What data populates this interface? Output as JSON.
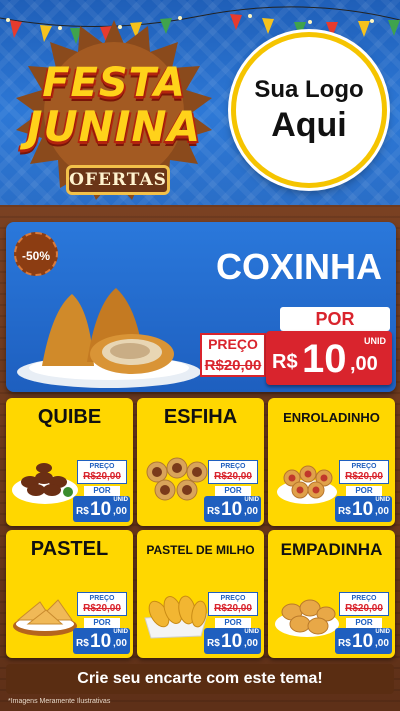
{
  "header": {
    "festa_line1": "FESTA",
    "festa_line2": "JUNINA",
    "ofertas": "OFERTAS",
    "logo_line1": "Sua Logo",
    "logo_line2": "Aqui"
  },
  "featured": {
    "discount": "-50%",
    "name": "COXINHA",
    "preco_label": "PREÇO",
    "old_price": "R$20,00",
    "por_label": "POR",
    "currency": "R$",
    "new_int": "10",
    "new_dec": ",00",
    "unit": "UNID"
  },
  "products": [
    {
      "name": "QUIBE",
      "preco_label": "PREÇO",
      "old_price": "R$20,00",
      "por_label": "POR",
      "currency": "R$",
      "new_int": "10",
      "new_dec": ",00",
      "unit": "UNID"
    },
    {
      "name": "ESFIHA",
      "preco_label": "PREÇO",
      "old_price": "R$20,00",
      "por_label": "POR",
      "currency": "R$",
      "new_int": "10",
      "new_dec": ",00",
      "unit": "UNID"
    },
    {
      "name": "ENROLADINHO",
      "preco_label": "PREÇO",
      "old_price": "R$20,00",
      "por_label": "POR",
      "currency": "R$",
      "new_int": "10",
      "new_dec": ",00",
      "unit": "UNID"
    },
    {
      "name": "PASTEL",
      "preco_label": "PREÇO",
      "old_price": "R$20,00",
      "por_label": "POR",
      "currency": "R$",
      "new_int": "10",
      "new_dec": ",00",
      "unit": "UNID"
    },
    {
      "name": "PASTEL DE MILHO",
      "preco_label": "PREÇO",
      "old_price": "R$20,00",
      "por_label": "POR",
      "currency": "R$",
      "new_int": "10",
      "new_dec": ",00",
      "unit": "UNID"
    },
    {
      "name": "EMPADINHA",
      "preco_label": "PREÇO",
      "old_price": "R$20,00",
      "por_label": "POR",
      "currency": "R$",
      "new_int": "10",
      "new_dec": ",00",
      "unit": "UNID"
    }
  ],
  "footer": {
    "cta": "Crie seu encarte com este tema!",
    "disclaimer": "*Imagens Meramente Ilustrativas"
  },
  "colors": {
    "header_blue": "#2d78d6",
    "card_yellow": "#ffd700",
    "price_red": "#d9242d",
    "price_blue": "#1f5fbf",
    "wood_brown": "#6b3a1f"
  }
}
